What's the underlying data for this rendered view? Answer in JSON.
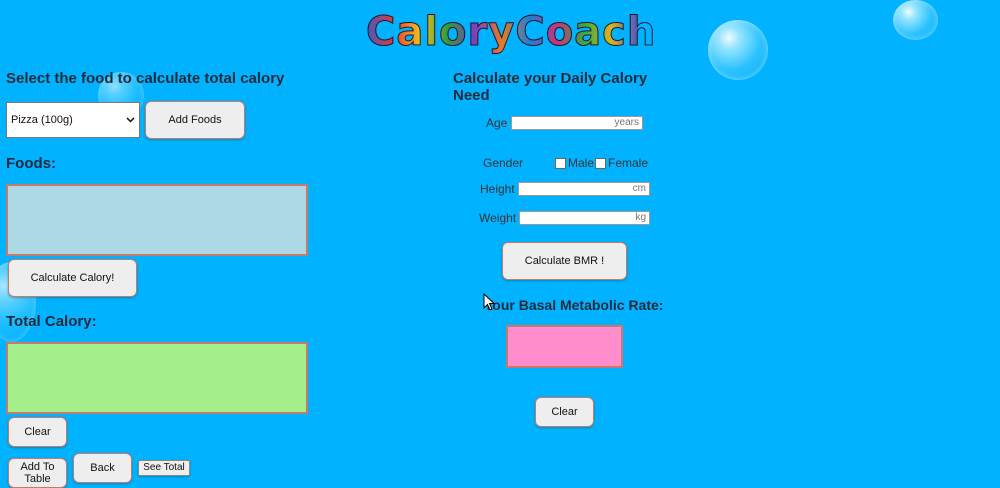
{
  "logo": "CaloryCoach",
  "left": {
    "heading": "Select the food to calculate total calory",
    "food_select": {
      "selected": "Pizza (100g)"
    },
    "add_foods": "Add Foods",
    "foods_label": "Foods:",
    "calculate_calory": "Calculate Calory!",
    "total_label": "Total Calory:",
    "clear": "Clear",
    "add_to_table": "Add To Table",
    "back": "Back",
    "see_total": "See Total"
  },
  "right": {
    "heading": "Calculate your Daily Calory Need",
    "age": {
      "label": "Age",
      "unit": "years"
    },
    "gender": {
      "label": "Gender",
      "male": "Male",
      "female": "Female"
    },
    "height": {
      "label": "Height",
      "unit": "cm"
    },
    "weight": {
      "label": "Weight",
      "unit": "kg"
    },
    "calculate_bmr": "Calculate BMR !",
    "bmr_label": "Your Basal Metabolic Rate:",
    "clear": "Clear"
  },
  "colors": {
    "background": "#00b2ff",
    "foods_box": "#add8e6",
    "total_box": "#a4ef8b",
    "bmr_box": "#ff8ccc"
  }
}
